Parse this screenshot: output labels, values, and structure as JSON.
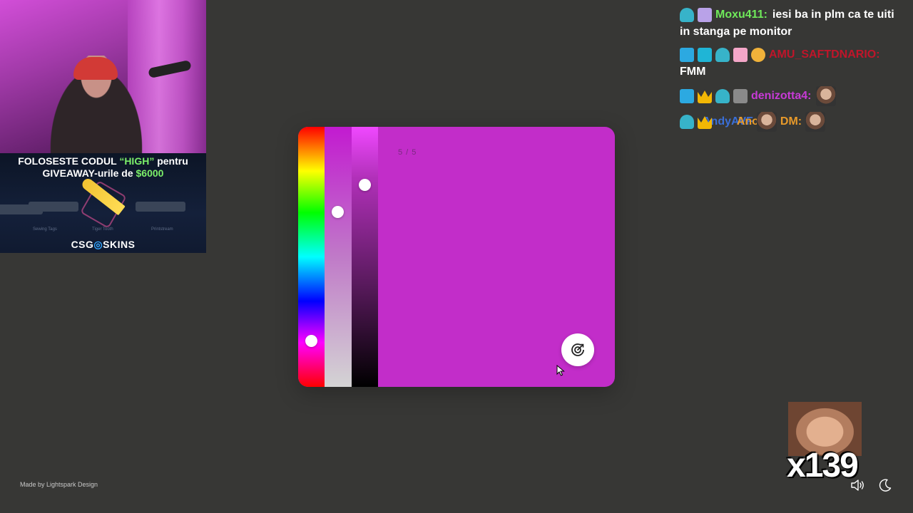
{
  "overlay": {
    "banner_line1_pre": "FOLOSESTE CODUL ",
    "banner_line1_code": "“HIGH”",
    "banner_line1_post": " pentru",
    "banner_line2_pre": "GIVEAWAY-urile de ",
    "banner_line2_amount": "$6000",
    "skin_labels": [
      "Sewing Tags",
      "Tiger Tooth",
      "Printstream"
    ],
    "logo_pre": "CSG",
    "logo_o": "◎",
    "logo_post": "SKINS",
    "accent": "#7cf06a"
  },
  "picker": {
    "background": "#c22dc9",
    "counter": "5 / 5",
    "hue_level": 0.84,
    "saturation_level": 0.32,
    "lightness_level": 0.21
  },
  "chat": {
    "messages": [
      {
        "badges": [
          "monster-icon",
          "gift-icon"
        ],
        "username": "Moxu411:",
        "username_color": "#6fea5a",
        "text_inline": "iesi ba in plm ca te uiti",
        "text_wrap": "in stanga pe monitor"
      },
      {
        "badges": [
          "mod-icon",
          "bg-icon",
          "monster-icon",
          "gift-icon",
          "7tv-icon"
        ],
        "username": "AMU_SAFTDNARIO:",
        "username_color": "#c0152a",
        "text_wrap": "FMM"
      },
      {
        "badges": [
          "mod-icon",
          "crown-icon",
          "monster-icon",
          "face-icon"
        ],
        "username": "denizotta4:",
        "username_color": "#c73ad6",
        "has_emote": true
      },
      {
        "badges": [
          "monster-icon",
          "crown-icon",
          "monster-icon"
        ],
        "username": "AndyAVF",
        "username_color": "#3a6fd8",
        "mention": "Ano",
        "suffix": "DM:",
        "suffix_color": "#e89a2a",
        "has_emote": true
      }
    ]
  },
  "footer": {
    "made_by": "Made by Lightspark Design",
    "combo": "x139"
  }
}
